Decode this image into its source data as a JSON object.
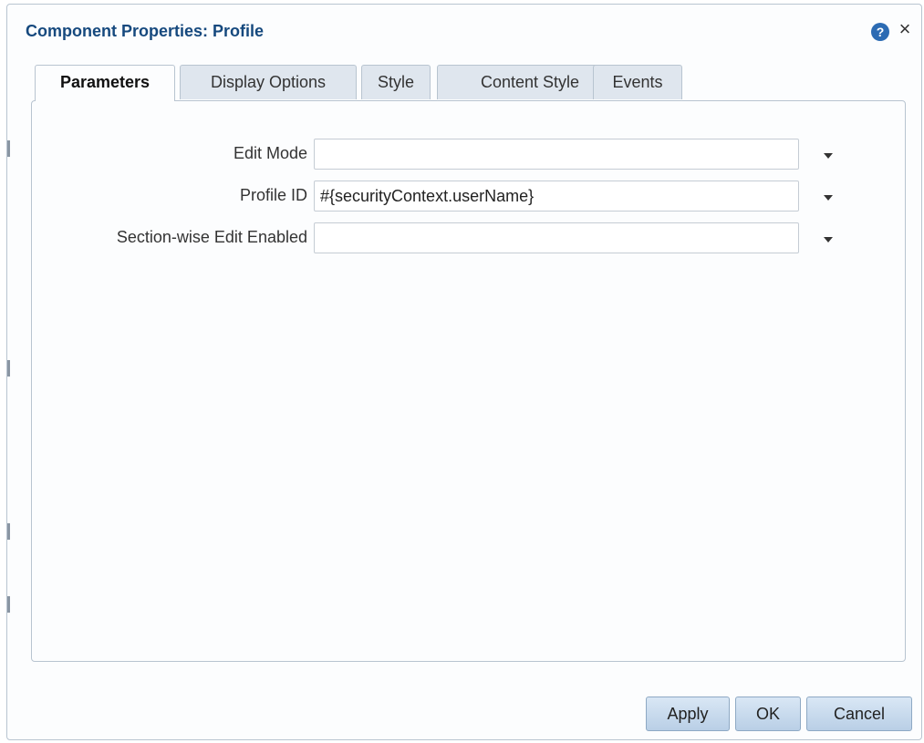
{
  "dialog": {
    "title": "Component Properties: Profile",
    "help_icon": "help-icon",
    "help_glyph": "?",
    "close_icon": "close-icon",
    "close_glyph": "×"
  },
  "tabs": [
    {
      "label": "Parameters",
      "active": true
    },
    {
      "label": "Display Options",
      "active": false
    },
    {
      "label": "Style",
      "active": false
    },
    {
      "label": "Content Style",
      "active": false
    },
    {
      "label": "Events",
      "active": false
    }
  ],
  "parameters": [
    {
      "label": "Edit Mode",
      "value": ""
    },
    {
      "label": "Profile ID",
      "value": "#{securityContext.userName}"
    },
    {
      "label": "Section-wise Edit Enabled",
      "value": ""
    }
  ],
  "buttons": {
    "apply": "Apply",
    "ok": "OK",
    "cancel": "Cancel"
  },
  "colors": {
    "title": "#16497e",
    "help_icon": "#2c6bb3",
    "button_bg": "#c6d9ec",
    "tab_inactive": "#dfe6ee",
    "border": "#b8c4d0"
  }
}
